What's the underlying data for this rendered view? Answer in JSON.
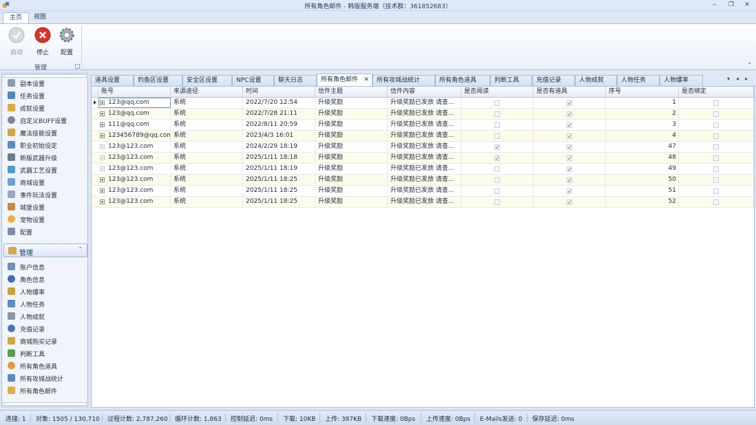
{
  "window": {
    "title": "所有角色邮件 - 韩版服务端（技术群：361852683）",
    "minimize": "‒",
    "restore": "❐",
    "close": "✕"
  },
  "ribbon": {
    "tabs": [
      "主页",
      "视图"
    ],
    "buttons": {
      "start": "启动",
      "stop": "停止",
      "config": "配置"
    },
    "group_label": "管理",
    "collapse": "⌃"
  },
  "nav": {
    "items_top": [
      "副本设置",
      "任务设置",
      "成就设置",
      "自定义BUFF设置",
      "魔法技能设置",
      "职业初始设定",
      "新版武器升级",
      "武器工艺设置",
      "商城设置",
      "事件玩法设置",
      "城堡设置",
      "宠物设置",
      "配置"
    ],
    "group": "管理",
    "group_chevron": "⌃",
    "items_manage": [
      "账户信息",
      "角色信息",
      "人物爆率",
      "人物任务",
      "人物成就",
      "充值记录",
      "商城购买记录",
      "判断工具",
      "所有角色道具",
      "所有攻城战统计",
      "所有角色邮件"
    ]
  },
  "doc_tabs": [
    "道具设置",
    "钓鱼区设置",
    "安全区设置",
    "NPC设置",
    "聊天日志",
    "所有角色邮件",
    "所有攻城战统计",
    "所有角色道具",
    "判断工具",
    "充值记录",
    "人物成就",
    "人物任务",
    "人物爆率"
  ],
  "doc_tab_close": "✕",
  "tab_nav": [
    "▾",
    "◂",
    "▸"
  ],
  "grid": {
    "columns": [
      "账号",
      "来源途径",
      "时间",
      "信件主题",
      "信件内容",
      "是否阅读",
      "是否有道具",
      "序号",
      "是否绑定"
    ],
    "rows": [
      {
        "account": "123@qq.com",
        "source": "系统",
        "time": "2022/7/20 12:54",
        "subject": "升级奖励",
        "content": "升级奖励已发放 请查...",
        "read": false,
        "has_item": true,
        "no": "1",
        "bound": false
      },
      {
        "account": "123@qq.com",
        "source": "系统",
        "time": "2022/7/28 21:11",
        "subject": "升级奖励",
        "content": "升级奖励已发放 请查...",
        "read": false,
        "has_item": true,
        "no": "2",
        "bound": false
      },
      {
        "account": "111@qq.com",
        "source": "系统",
        "time": "2022/8/11 20:59",
        "subject": "升级奖励",
        "content": "升级奖励已发放 请查...",
        "read": false,
        "has_item": true,
        "no": "3",
        "bound": false
      },
      {
        "account": "123456789@qq.com",
        "source": "系统",
        "time": "2023/4/3 16:01",
        "subject": "升级奖励",
        "content": "升级奖励已发放 请查...",
        "read": false,
        "has_item": true,
        "no": "4",
        "bound": false
      },
      {
        "account": "123@123.com",
        "source": "系统",
        "time": "2024/2/29 18:19",
        "subject": "升级奖励",
        "content": "升级奖励已发放 请查...",
        "read": true,
        "has_item": true,
        "no": "47",
        "bound": false
      },
      {
        "account": "123@123.com",
        "source": "系统",
        "time": "2025/1/11 18:18",
        "subject": "升级奖励",
        "content": "升级奖励已发放 请查...",
        "read": true,
        "has_item": true,
        "no": "48",
        "bound": false
      },
      {
        "account": "123@123.com",
        "source": "系统",
        "time": "2025/1/11 18:19",
        "subject": "升级奖励",
        "content": "升级奖励已发放 请查...",
        "read": false,
        "has_item": true,
        "no": "49",
        "bound": false
      },
      {
        "account": "123@123.com",
        "source": "系统",
        "time": "2025/1/11 18:25",
        "subject": "升级奖励",
        "content": "升级奖励已发放 请查...",
        "read": false,
        "has_item": true,
        "no": "50",
        "bound": false
      },
      {
        "account": "123@123.com",
        "source": "系统",
        "time": "2025/1/11 18:25",
        "subject": "升级奖励",
        "content": "升级奖励已发放 请查...",
        "read": false,
        "has_item": true,
        "no": "51",
        "bound": false
      },
      {
        "account": "123@123.com",
        "source": "系统",
        "time": "2025/1/11 18:25",
        "subject": "升级奖励",
        "content": "升级奖励已发放 请查...",
        "read": false,
        "has_item": true,
        "no": "52",
        "bound": false
      }
    ]
  },
  "status": [
    "连接: 1",
    "对象: 1505 / 130,710",
    "过程计数: 2,787,260",
    "循环计数: 1,863",
    "控制延迟: 0ms",
    "下载: 10KB",
    "上传: 387KB",
    "下载速度: 0Bps",
    "上传速度: 0Bps",
    "E-Mails发送: 0",
    "保存延迟: 0ms"
  ],
  "colors": {
    "accent": "#dfe8f6",
    "row_alt": "#fdfbe9",
    "stop_red": "#d9342b"
  },
  "check_glyph": "✓"
}
